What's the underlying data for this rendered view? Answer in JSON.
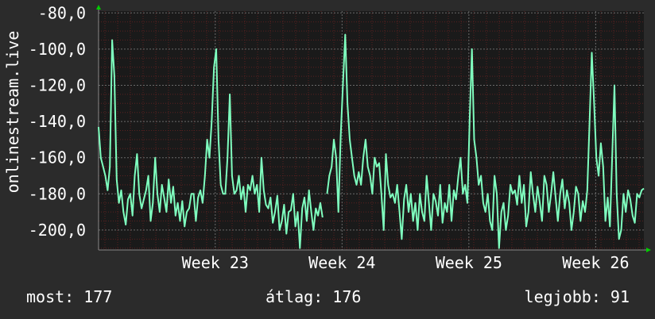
{
  "chart_data": {
    "type": "line",
    "ylabel": "onlinestream.live",
    "ylim": [
      -211,
      -79
    ],
    "ytick_values": [
      -80,
      -100,
      -120,
      -140,
      -160,
      -180,
      -200
    ],
    "ytick_labels": [
      "-80,0",
      "-100,0",
      "-120,0",
      "-140,0",
      "-160,0",
      "-180,0",
      "-200,0"
    ],
    "xlim": [
      0,
      43
    ],
    "xtick_values": [
      9.2,
      19.2,
      29.2,
      39.2
    ],
    "xtick_labels": [
      "Week 23",
      "Week 24",
      "Week 25",
      "Week 26"
    ],
    "grid": true,
    "colors": {
      "background": "#2b2b2b",
      "plot": "#1a1a1a",
      "line": "#7fffbf",
      "grid_minor": "#5a2020",
      "grid_major": "#6a6a6a",
      "axis_arrow": "#00cc00"
    },
    "series": [
      {
        "values": [
          -143,
          -160,
          -165,
          -170,
          -178,
          -165,
          -95,
          -115,
          -172,
          -185,
          -178,
          -190,
          -197,
          -183,
          -180,
          -192,
          -170,
          -158,
          -180,
          -188,
          -183,
          -178,
          -170,
          -195,
          -185,
          -160,
          -180,
          -190,
          -175,
          -182,
          -190,
          -172,
          -185,
          -176,
          -192,
          -185,
          -195,
          -184,
          -198,
          -190,
          -188,
          -180,
          -180,
          -195,
          -182,
          -178,
          -185,
          -170,
          -150,
          -160,
          -140,
          -110,
          -100,
          -150,
          -175,
          -180,
          -180,
          -160,
          -125,
          -170,
          -180,
          -178,
          -170,
          -183,
          -176,
          -190,
          -175,
          -178,
          -170,
          -180,
          -175,
          -190,
          -160,
          -178,
          -186,
          -188,
          -182,
          -196,
          -190,
          -181,
          -200,
          -195,
          -186,
          -202,
          -190,
          -189,
          -180,
          -198,
          -190,
          -210,
          -188,
          -182,
          -195,
          -178,
          -190,
          -200,
          -188,
          -192,
          -185,
          -193,
          null,
          -180,
          -170,
          -165,
          -150,
          -160,
          -190,
          -148,
          -120,
          -92,
          -130,
          -150,
          -160,
          -170,
          -175,
          -168,
          -175,
          -160,
          -150,
          -165,
          -170,
          -180,
          -160,
          -165,
          -163,
          -180,
          -200,
          -158,
          -175,
          -182,
          -180,
          -185,
          -175,
          -190,
          -205,
          -183,
          -175,
          -190,
          -180,
          -195,
          -185,
          -200,
          -180,
          -190,
          -195,
          -170,
          -185,
          -200,
          -180,
          -184,
          -192,
          -175,
          -196,
          -185,
          -190,
          -175,
          -195,
          -178,
          -183,
          -170,
          -160,
          -180,
          -175,
          -185,
          -140,
          -100,
          -150,
          -160,
          -175,
          -170,
          -185,
          -190,
          -180,
          -195,
          -200,
          -170,
          -180,
          -210,
          -190,
          -185,
          -200,
          -192,
          -175,
          -180,
          -178,
          -186,
          -170,
          -185,
          -175,
          -198,
          -190,
          -168,
          -180,
          -190,
          -176,
          -185,
          -195,
          -170,
          -175,
          -190,
          -180,
          -168,
          -182,
          -195,
          -180,
          -172,
          -188,
          -178,
          -185,
          -200,
          -190,
          -176,
          -180,
          -195,
          -184,
          -190,
          -178,
          -140,
          -102,
          -130,
          -160,
          -170,
          -152,
          -165,
          -195,
          -182,
          -198,
          -160,
          -120,
          -180,
          -205,
          -200,
          -180,
          -190,
          -178,
          -183,
          -192,
          -196,
          -180,
          -182,
          -178,
          -177
        ]
      }
    ]
  },
  "footer": {
    "current": "most: 177",
    "average": "átlag: 176",
    "best": "legjobb: 91"
  }
}
